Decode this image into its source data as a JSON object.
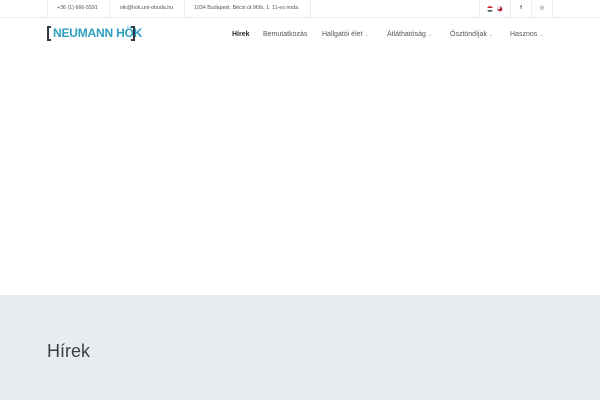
{
  "topbar": {
    "phone": "+36 (1) 666-5591",
    "email": "nik@hok.uni-obuda.hu",
    "address": "1034 Budapest, Bécsi út 96/b, 1. 11-es iroda",
    "languages": [
      "hu",
      "en"
    ],
    "social": [
      {
        "name": "facebook",
        "glyph": "f"
      },
      {
        "name": "instagram",
        "glyph": "◎"
      }
    ]
  },
  "logo": {
    "text": "NEUMANN HÖK",
    "color": "#2e9fc0"
  },
  "nav": {
    "items": [
      {
        "label": "Hírek",
        "active": true,
        "dropdown": false
      },
      {
        "label": "Bemutatkozás",
        "active": false,
        "dropdown": false
      },
      {
        "label": "Hallgatói élet",
        "active": false,
        "dropdown": true
      },
      {
        "label": "Átláthatóság",
        "active": false,
        "dropdown": true
      },
      {
        "label": "Ösztöndíjak",
        "active": false,
        "dropdown": true
      },
      {
        "label": "Hasznos",
        "active": false,
        "dropdown": true
      }
    ]
  },
  "page": {
    "title": "Hírek"
  },
  "colors": {
    "band": "#e9ecef",
    "accent": "#2e9fc0"
  }
}
